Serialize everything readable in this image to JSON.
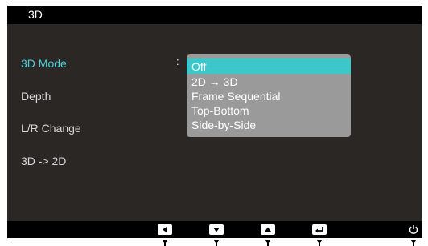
{
  "osd": {
    "title": "3D"
  },
  "menu": {
    "items": [
      {
        "label": "3D Mode",
        "selected": true
      },
      {
        "label": "Depth",
        "selected": false
      },
      {
        "label": "L/R Change",
        "selected": false
      },
      {
        "label": "3D -> 2D",
        "selected": false
      }
    ],
    "separator": ":"
  },
  "dropdown": {
    "options": [
      {
        "label": "Off",
        "active": true
      },
      {
        "label": "2D → 3D",
        "active": false
      },
      {
        "label": "Frame Sequential",
        "active": false
      },
      {
        "label": "Top-Bottom",
        "active": false
      },
      {
        "label": "Side-by-Side",
        "active": false
      }
    ]
  },
  "colors": {
    "panel_bg": "#2b2725",
    "bar_bg": "#000000",
    "selected_text": "#49d1d9",
    "highlight": "#3cc8c8",
    "dropdown_bg": "#9a9a9a"
  },
  "controls": {
    "icons": [
      "left-arrow-icon",
      "down-arrow-icon",
      "up-arrow-icon",
      "enter-icon",
      "power-icon"
    ]
  }
}
